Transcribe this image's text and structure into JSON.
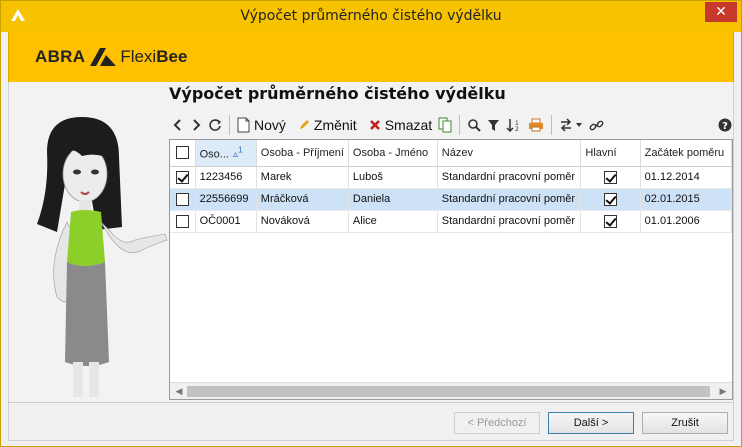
{
  "window": {
    "title": "Výpočet průměrného čistého výdělku",
    "close_label": "✕"
  },
  "brand": {
    "abra": "ABRA",
    "flexi": "Flexi",
    "bee": "Bee"
  },
  "page_title": "Výpočet průměrného čistého výdělku",
  "toolbar": {
    "new_label": "Nový",
    "edit_label": "Změnit",
    "delete_label": "Smazat"
  },
  "grid": {
    "headers": [
      "Oso...",
      "Osoba - Příjmení",
      "Osoba - Jméno",
      "Název",
      "Hlavní",
      "Začátek poměru"
    ],
    "sort_indicator": "1",
    "rows": [
      {
        "checked": true,
        "id": "1223456",
        "surname": "Marek",
        "first": "Luboš",
        "name": "Standardní pracovní poměr",
        "main": true,
        "start": "01.12.2014"
      },
      {
        "checked": false,
        "id": "22556699",
        "surname": "Mráčková",
        "first": "Daniela",
        "name": "Standardní pracovní poměr",
        "main": true,
        "start": "02.01.2015"
      },
      {
        "checked": false,
        "id": "OČ0001",
        "surname": "Nováková",
        "first": "Alice",
        "name": "Standardní pracovní poměr",
        "main": true,
        "start": "01.01.2006"
      }
    ]
  },
  "buttons": {
    "prev": "< Předchozí",
    "next": "Další >",
    "cancel": "Zrušit"
  },
  "colors": {
    "brand_yellow": "#ffc000",
    "selection": "#cde2f7",
    "close_red": "#c7392b"
  }
}
